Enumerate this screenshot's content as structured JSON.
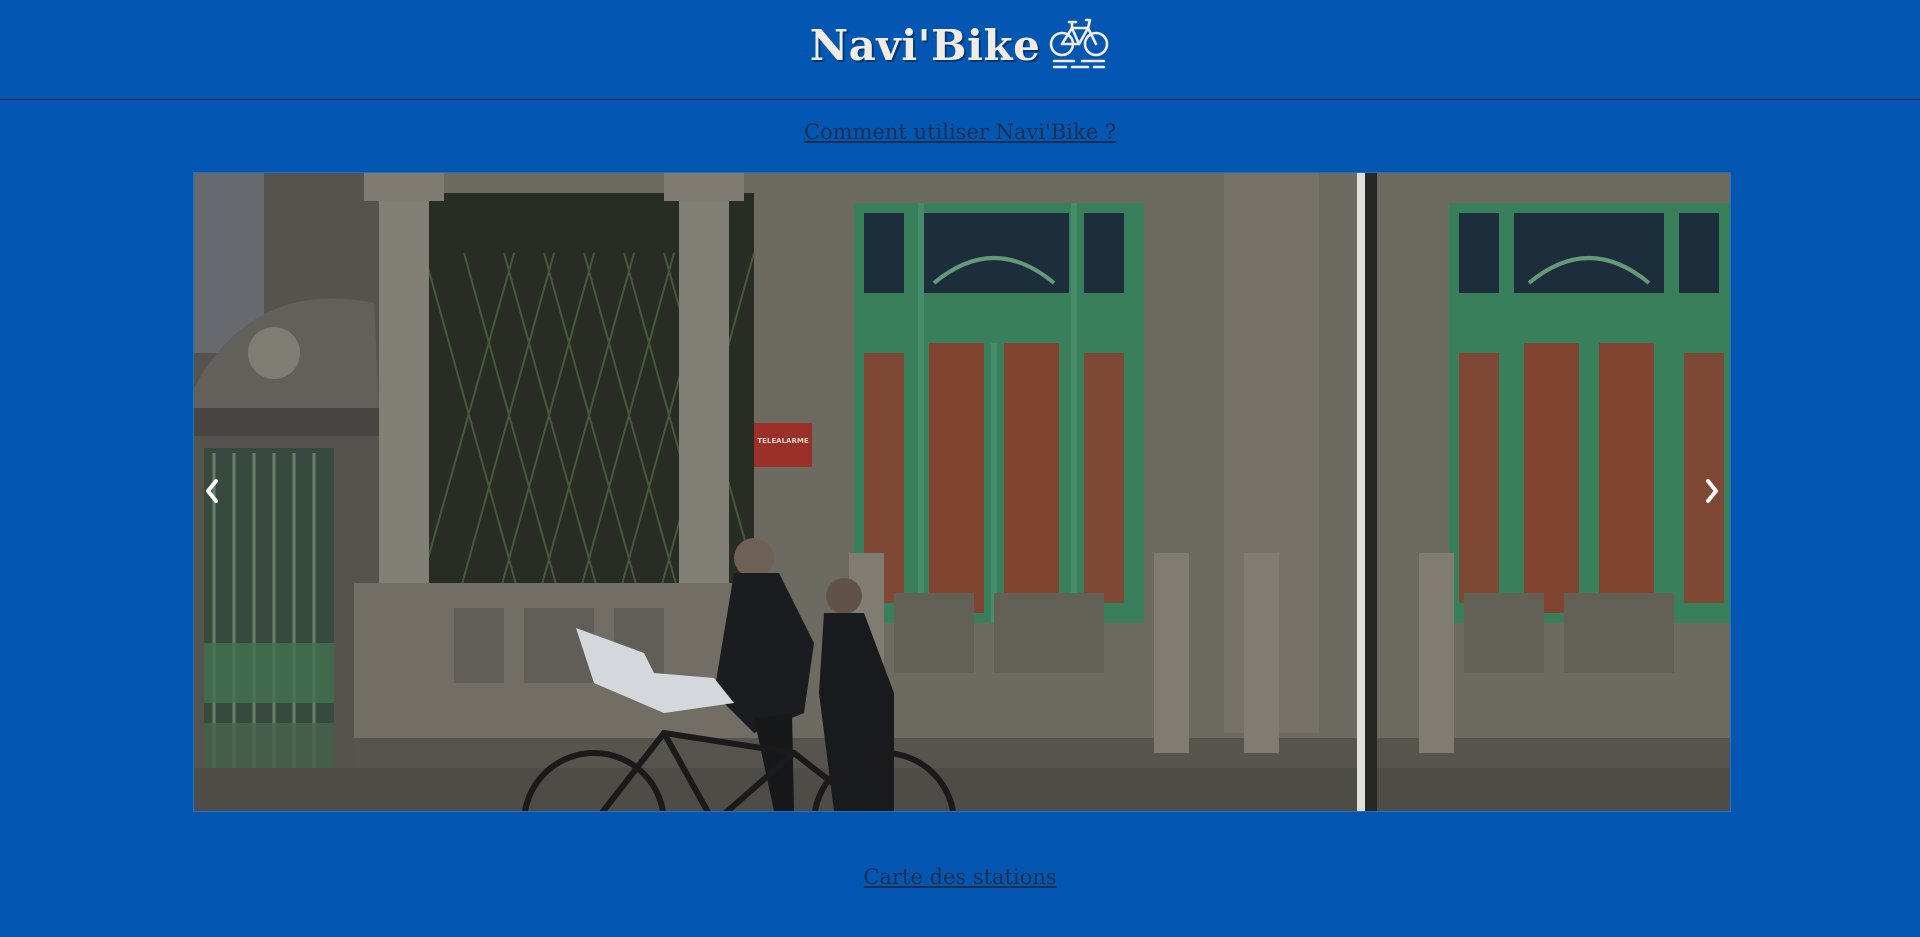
{
  "header": {
    "title": "Navi'Bike",
    "logo_icon": "bicycle-icon"
  },
  "links": {
    "how_to_use": "Comment utiliser Navi'Bike ?",
    "station_map": "Carte des stations"
  },
  "carousel": {
    "prev_icon": "chevron-left-icon",
    "next_icon": "chevron-right-icon",
    "sign_text": "TELEALARME"
  },
  "colors": {
    "background": "#0357b2",
    "title": "#f1ede6",
    "link": "#1b2f4d"
  }
}
